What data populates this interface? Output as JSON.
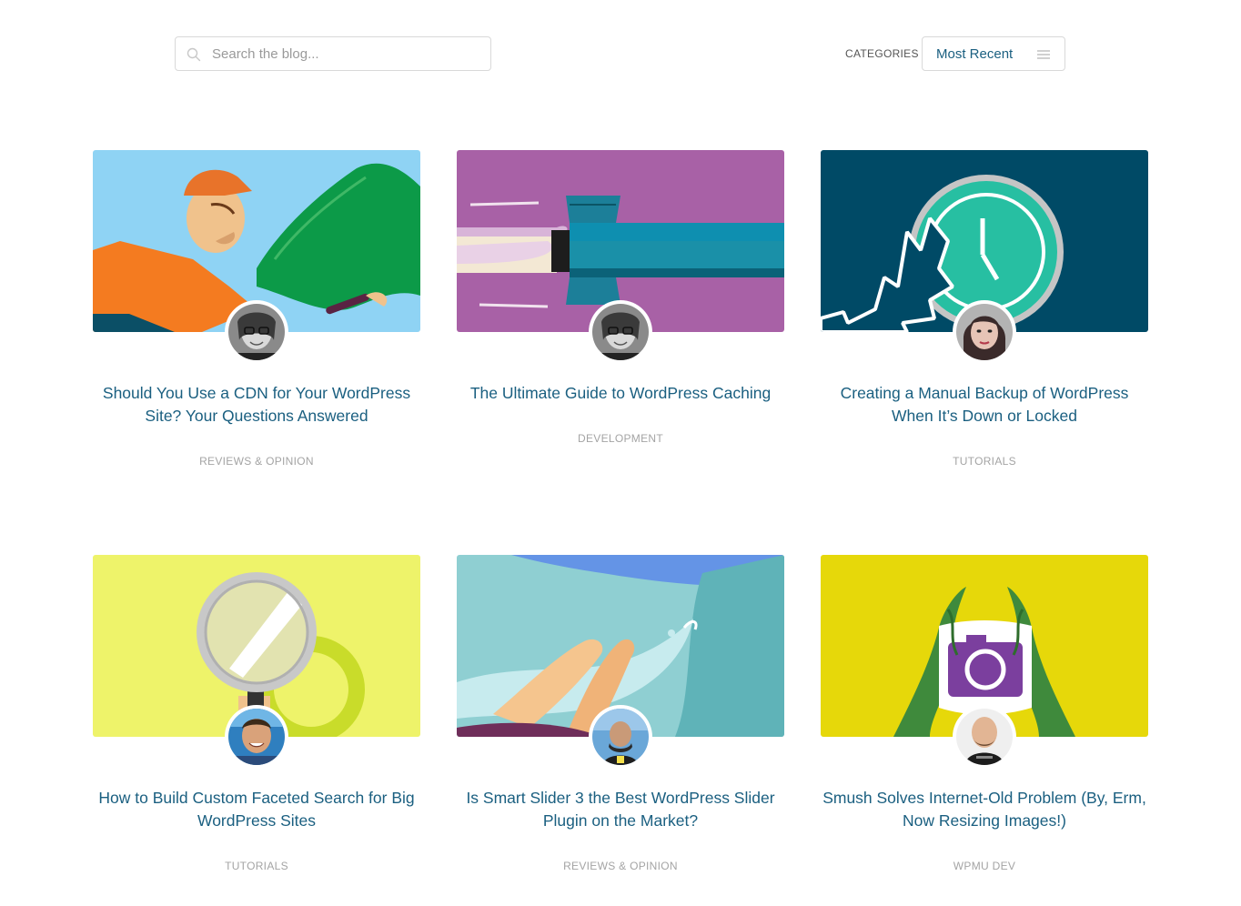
{
  "search": {
    "placeholder": "Search the blog...",
    "value": ""
  },
  "filter": {
    "label": "CATEGORIES",
    "selected": "Most Recent"
  },
  "posts": [
    {
      "title": "Should You Use a CDN for Your WordPress Site? Your Questions Answered",
      "category": "REVIEWS & OPINION",
      "image_bg": "#8fd3f4",
      "author_icon": "author-avatar-woman-glasses"
    },
    {
      "title": "The Ultimate Guide to WordPress Caching",
      "category": "DEVELOPMENT",
      "image_bg": "#a861a6",
      "author_icon": "author-avatar-woman-glasses"
    },
    {
      "title": "Creating a Manual Backup of WordPress When It’s Down or Locked",
      "category": "TUTORIALS",
      "image_bg": "#004a66",
      "author_icon": "author-avatar-woman-dark-hair"
    },
    {
      "title": "How to Build Custom Faceted Search for Big WordPress Sites",
      "category": "TUTORIALS",
      "image_bg": "#eef36a",
      "author_icon": "author-avatar-man-smiling"
    },
    {
      "title": "Is Smart Slider 3 the Best WordPress Slider Plugin on the Market?",
      "category": "REVIEWS & OPINION",
      "image_bg": "#8fcfcf",
      "author_icon": "author-avatar-man-conference"
    },
    {
      "title": "Smush Solves Internet-Old Problem (By, Erm, Now Resizing Images!)",
      "category": "WPMU DEV",
      "image_bg": "#e6d80a",
      "author_icon": "author-avatar-man-bald"
    }
  ]
}
